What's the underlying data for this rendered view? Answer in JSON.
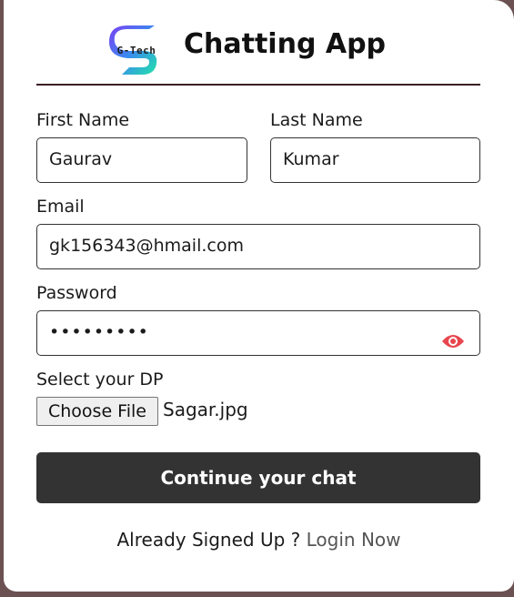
{
  "header": {
    "logo_text": "G-Tech",
    "title": "Chatting App"
  },
  "form": {
    "first_name": {
      "label": "First Name",
      "value": "Gaurav"
    },
    "last_name": {
      "label": "Last Name",
      "value": "Kumar"
    },
    "email": {
      "label": "Email",
      "value": "gk156343@hmail.com"
    },
    "password": {
      "label": "Password",
      "value": "•••••••••",
      "toggle_icon": "eye-icon"
    },
    "dp": {
      "label": "Select your DP",
      "button": "Choose File",
      "file_name": "Sagar.jpg"
    },
    "submit_label": "Continue your chat"
  },
  "footer": {
    "text": "Already Signed Up ? ",
    "link": "Login Now"
  },
  "colors": {
    "accent_button": "#333333",
    "eye_icon": "#e8454d",
    "background": "#6b5151"
  }
}
